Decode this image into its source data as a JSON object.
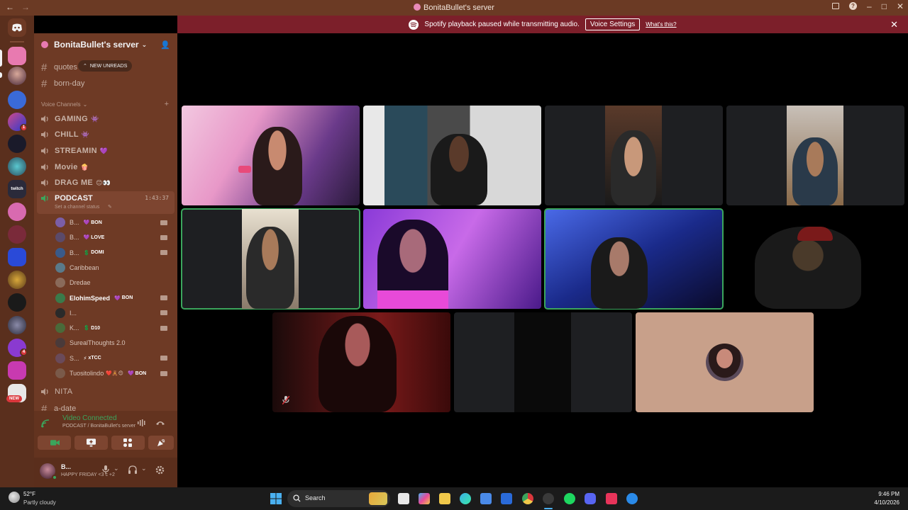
{
  "window": {
    "title": "BonitaBullet's server",
    "back": "←",
    "forward": "→"
  },
  "banner": {
    "message": "Spotify playback paused while transmitting audio.",
    "button": "Voice Settings",
    "link": "What's this?",
    "close": "✕"
  },
  "server": {
    "name": "BonitaBullet's server",
    "channels": [
      {
        "name": "quotes",
        "symbol": "#"
      },
      {
        "name": "born-day",
        "symbol": "#"
      }
    ],
    "new_unreads": "NEW UNREADS",
    "voice_category": "Voice Channels",
    "voice_channels": [
      {
        "name": "GAMING",
        "emoji": "👾"
      },
      {
        "name": "CHILL",
        "emoji": "👾"
      },
      {
        "name": "STREAMIN",
        "emoji": "💜"
      },
      {
        "name": "Movie",
        "emoji": "🍿"
      },
      {
        "name": "DRAG ME",
        "emoji": "😊👀"
      }
    ],
    "active_voice": {
      "name": "PODCAST",
      "timer": "1:43:37",
      "status": "Set a channel status"
    },
    "members": [
      {
        "name": "B...",
        "tag": "BON",
        "tag_icon": "💜",
        "color": "#7b5ea7"
      },
      {
        "name": "B...",
        "tag": "LOVE",
        "tag_icon": "💜",
        "color": "#5b4a6a"
      },
      {
        "name": "B...",
        "tag": "DOMI",
        "tag_icon": "💲",
        "color": "#3a5a8a"
      },
      {
        "name": "Caribbean",
        "tag": "",
        "tag_icon": "",
        "color": "#5a7a8a"
      },
      {
        "name": "Dredae",
        "tag": "",
        "tag_icon": "",
        "color": "#8a6a5a"
      },
      {
        "name": "ElohimSpeed",
        "tag": "BON",
        "tag_icon": "💜",
        "color": "#3a7a4a"
      },
      {
        "name": "I...",
        "tag": "",
        "tag_icon": "",
        "color": "#2a2a2a"
      },
      {
        "name": "K...",
        "tag": "D10",
        "tag_icon": "💲",
        "color": "#4a6a3a"
      },
      {
        "name": "SurealThoughts 2.0",
        "tag": "",
        "tag_icon": "",
        "color": "#4a3a3a"
      },
      {
        "name": "S...",
        "tag": "xTCC",
        "tag_icon": "⚡",
        "color": "#6a4a5a"
      },
      {
        "name": "Tuositolindo",
        "tag": "BON",
        "tag_icon": "💜",
        "color": "#7a5a4a",
        "emojis": "❤️🧸😊"
      }
    ],
    "more_channels": [
      {
        "name": "NITA",
        "symbol": "🔊"
      },
      {
        "name": "a-date",
        "symbol": "#"
      }
    ]
  },
  "voice_panel": {
    "status": "Video Connected",
    "location": "PODCAST / BonitaBullet's server"
  },
  "user": {
    "name": "B...",
    "status": "HAPPY FRIDAY <3 c +2"
  },
  "taskbar": {
    "weather_temp": "52°F",
    "weather_desc": "Partly cloudy",
    "search": "Search",
    "time": "9:46 PM",
    "date": "4/10/2026"
  },
  "guild_new_label": "NEW",
  "guild_badges": [
    "1",
    "4"
  ],
  "colors": {
    "accent": "#3ba55c",
    "banner": "#7c1f2a",
    "sidebar": "#6e3a25"
  }
}
